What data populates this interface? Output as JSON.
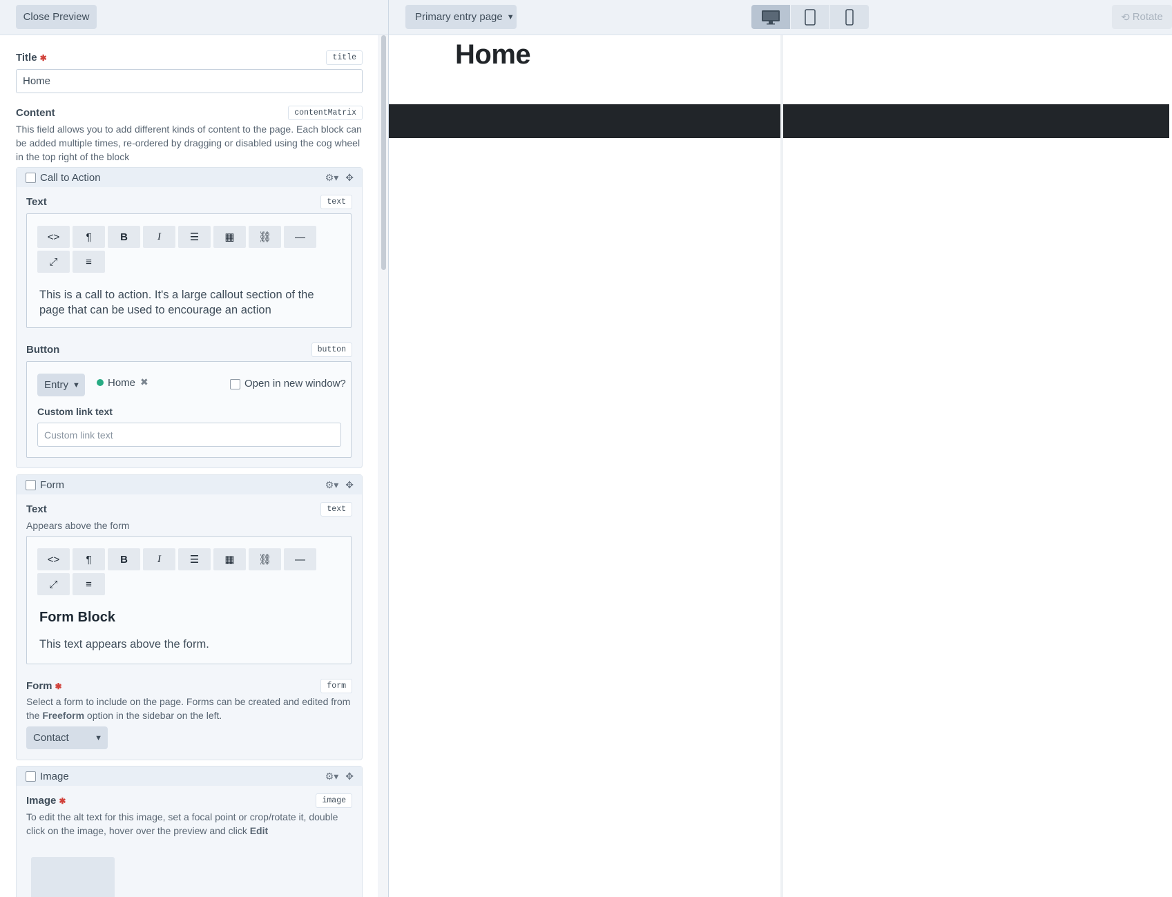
{
  "editor": {
    "close_preview": "Close Preview",
    "title_field": {
      "label": "Title",
      "handle": "title",
      "value": "Home"
    },
    "content_field": {
      "label": "Content",
      "handle": "contentMatrix",
      "help": "This field allows you to add different kinds of content to the page. Each block can be added multiple times, re-ordered by dragging or disabled using the cog wheel in the top right of the block"
    },
    "blocks": {
      "cta": {
        "title": "Call to Action",
        "text_label": "Text",
        "text_handle": "text",
        "text_content": "This is a call to action. It's a large callout section of the page that can be used to encourage an action",
        "button_label": "Button",
        "button_handle": "button",
        "link_type": "Entry",
        "linked_entry": "Home",
        "open_new_window": "Open in new window?",
        "custom_link_label": "Custom link text",
        "custom_link_placeholder": "Custom link text"
      },
      "form": {
        "title": "Form",
        "text_label": "Text",
        "text_handle": "text",
        "text_help": "Appears above the form",
        "heading": "Form Block",
        "paragraph": "This text appears above the form.",
        "form_label": "Form",
        "form_handle": "form",
        "form_help_1": "Select a form to include on the page. Forms can be created and edited from the ",
        "form_help_bold": "Freeform",
        "form_help_2": " option in the sidebar on the left.",
        "form_value": "Contact"
      },
      "image": {
        "title": "Image",
        "image_label": "Image",
        "image_handle": "image",
        "help_1": "To edit the alt text for this image, set a focal point or crop/rotate it, double click on the image, hover over the preview and click ",
        "help_bold": "Edit"
      }
    }
  },
  "preview": {
    "target": "Primary entry page",
    "rotate": "Rotate",
    "devices": [
      "desktop-icon",
      "tablet-icon",
      "phone-icon"
    ],
    "page_title": "Home"
  },
  "colors": {
    "accent_dot": "#27ab83",
    "dark_bar": "#212529",
    "required": "#d1423b"
  }
}
